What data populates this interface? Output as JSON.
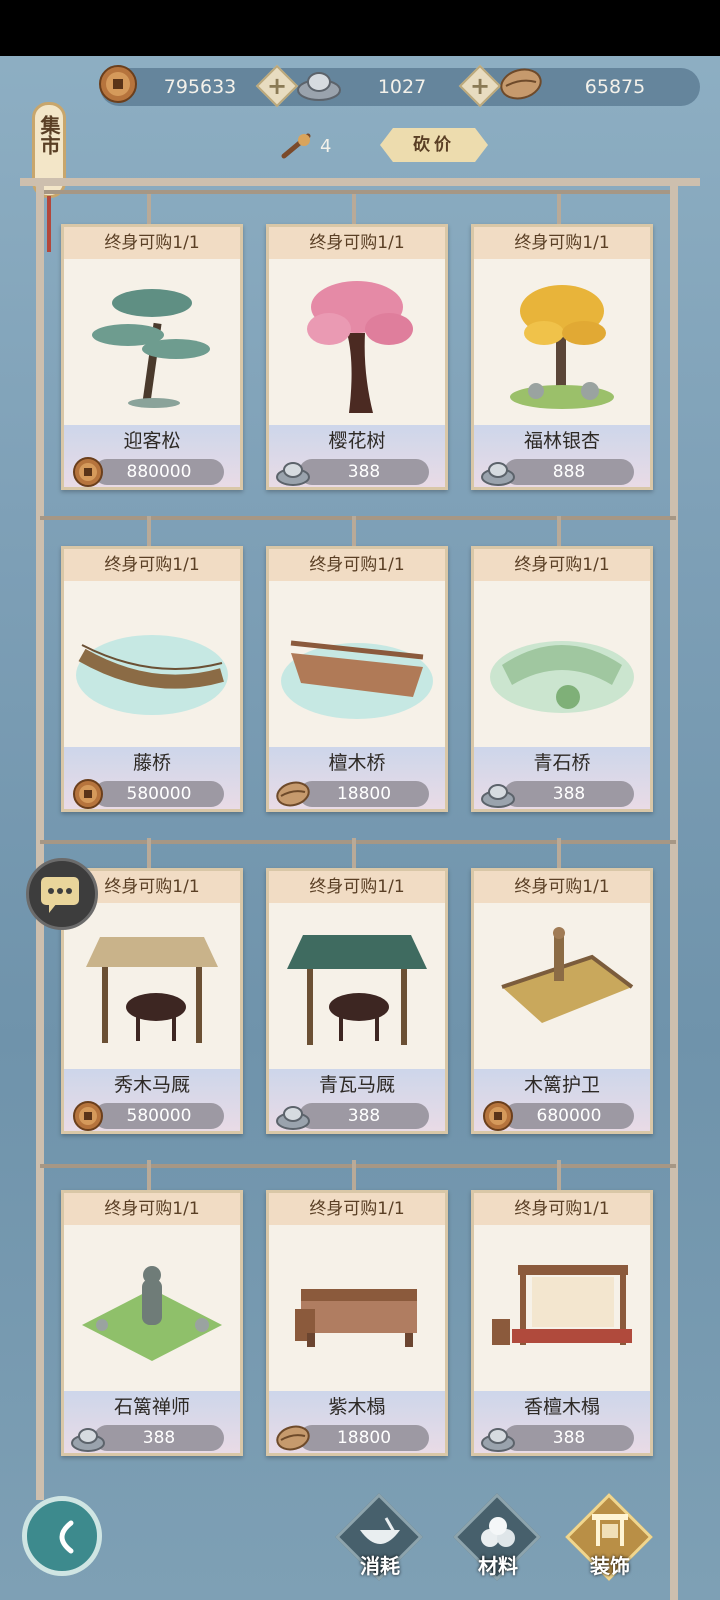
{
  "currencies": [
    {
      "icon": "copper-coin-icon",
      "value": "795633"
    },
    {
      "icon": "silver-ingot-icon",
      "value": "1027"
    },
    {
      "icon": "shell-icon",
      "value": "65875"
    }
  ],
  "market_tag": "集市",
  "bargain": {
    "count": "4",
    "button_label": "砍价"
  },
  "cards": [
    {
      "limit": "终身可购1/1",
      "name": "迎客松",
      "price": "880000",
      "currency_icon": "copper-coin-icon",
      "art": "pine-tree"
    },
    {
      "limit": "终身可购1/1",
      "name": "樱花树",
      "price": "388",
      "currency_icon": "silver-ingot-icon",
      "art": "cherry-tree"
    },
    {
      "limit": "终身可购1/1",
      "name": "福林银杏",
      "price": "888",
      "currency_icon": "silver-ingot-icon",
      "art": "ginkgo-tree"
    },
    {
      "limit": "终身可购1/1",
      "name": "藤桥",
      "price": "580000",
      "currency_icon": "copper-coin-icon",
      "art": "rope-bridge"
    },
    {
      "limit": "终身可购1/1",
      "name": "檀木桥",
      "price": "18800",
      "currency_icon": "shell-icon",
      "art": "wood-bridge"
    },
    {
      "limit": "终身可购1/1",
      "name": "青石桥",
      "price": "388",
      "currency_icon": "silver-ingot-icon",
      "art": "stone-bridge"
    },
    {
      "limit": "终身可购1/1",
      "name": "秀木马厩",
      "price": "580000",
      "currency_icon": "copper-coin-icon",
      "art": "wood-stable"
    },
    {
      "limit": "终身可购1/1",
      "name": "青瓦马厩",
      "price": "388",
      "currency_icon": "silver-ingot-icon",
      "art": "tile-stable"
    },
    {
      "limit": "终身可购1/1",
      "name": "木篱护卫",
      "price": "680000",
      "currency_icon": "copper-coin-icon",
      "art": "fence-guard"
    },
    {
      "limit": "终身可购1/1",
      "name": "石篱禅师",
      "price": "388",
      "currency_icon": "silver-ingot-icon",
      "art": "stone-zen"
    },
    {
      "limit": "终身可购1/1",
      "name": "紫木榻",
      "price": "18800",
      "currency_icon": "shell-icon",
      "art": "wood-couch"
    },
    {
      "limit": "终身可购1/1",
      "name": "香檀木榻",
      "price": "388",
      "currency_icon": "silver-ingot-icon",
      "art": "canopy-bed"
    }
  ],
  "nav": {
    "tabs": [
      {
        "label": "消耗",
        "icon": "bowl-icon",
        "active": false
      },
      {
        "label": "材料",
        "icon": "material-icon",
        "active": false
      },
      {
        "label": "装饰",
        "icon": "decoration-icon",
        "active": true
      }
    ]
  }
}
